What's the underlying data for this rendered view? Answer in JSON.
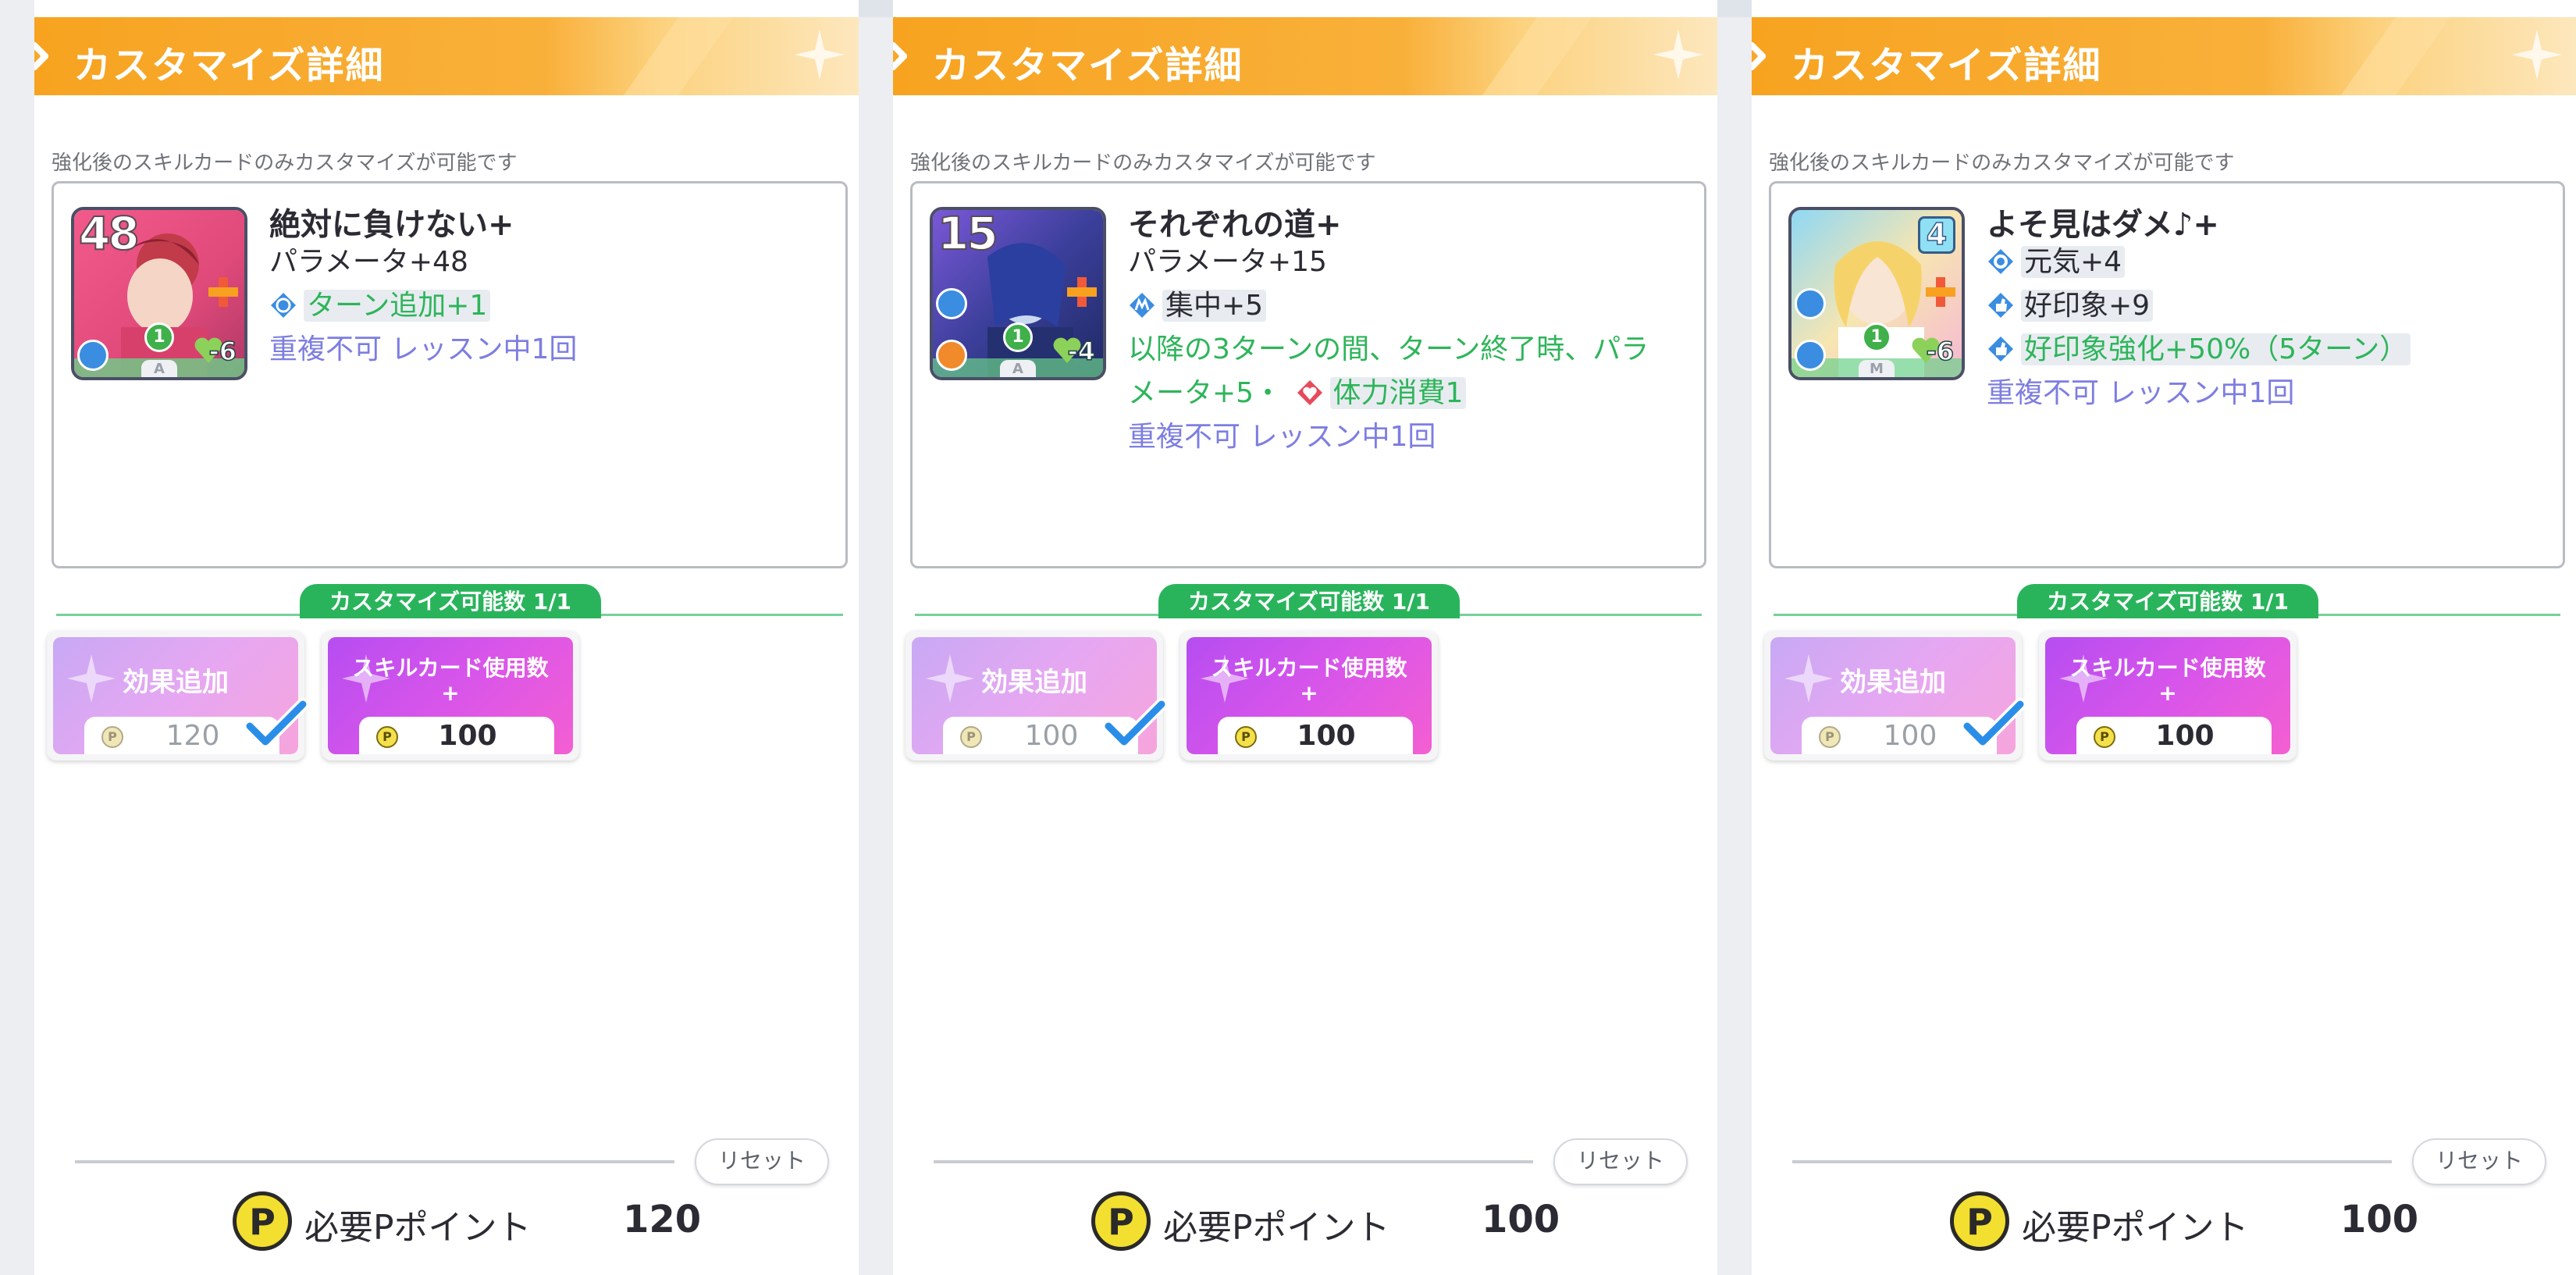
{
  "panels": [
    {
      "title": "カスタマイズ詳細",
      "note": "強化後のスキルカードのみカスタマイズが可能です",
      "card": {
        "cost": "48",
        "level": "1",
        "stamina": "-6",
        "rarity": "A",
        "name": "絶対に負けない+",
        "effects": [
          {
            "text": "パラメータ+48",
            "style": "black"
          },
          {
            "text": "ターン追加+1",
            "style": "green",
            "icon": "turn-icon"
          },
          {
            "text": "重複不可 レッスン中1回",
            "style": "purple"
          }
        ]
      },
      "customize_label": "カスタマイズ可能数 1/1",
      "options": [
        {
          "label": "効果追加",
          "price": "120",
          "selected": true
        },
        {
          "label": "スキルカード使用数+",
          "price": "100",
          "selected": false
        }
      ],
      "reset_label": "リセット",
      "required_label": "必要Pポイント",
      "required_value": "120"
    },
    {
      "title": "カスタマイズ詳細",
      "note": "強化後のスキルカードのみカスタマイズが可能です",
      "card": {
        "cost": "15",
        "level": "1",
        "stamina": "-4",
        "rarity": "A",
        "name": "それぞれの道+",
        "effects": [
          {
            "text": "パラメータ+15",
            "style": "black"
          },
          {
            "text": "集中+5",
            "style": "black",
            "icon": "focus-icon"
          },
          {
            "text": "以降の3ターンの間、ターン終了時、パラ",
            "style": "green"
          },
          {
            "text": "メータ+5・",
            "style": "green",
            "tail": "体力消費1",
            "tail_icon": "heart-icon"
          },
          {
            "text": "重複不可 レッスン中1回",
            "style": "purple"
          }
        ]
      },
      "customize_label": "カスタマイズ可能数 1/1",
      "options": [
        {
          "label": "効果追加",
          "price": "100",
          "selected": true
        },
        {
          "label": "スキルカード使用数+",
          "price": "100",
          "selected": false
        }
      ],
      "reset_label": "リセット",
      "required_label": "必要Pポイント",
      "required_value": "100"
    },
    {
      "title": "カスタマイズ詳細",
      "note": "強化後のスキルカードのみカスタマイズが可能です",
      "card": {
        "cost": "4",
        "level": "1",
        "stamina": "-6",
        "rarity": "M",
        "name": "よそ見はダメ♪+",
        "effects": [
          {
            "text": "元気+4",
            "style": "black",
            "icon": "genki-icon"
          },
          {
            "text": "好印象+9",
            "style": "black",
            "icon": "impression-icon"
          },
          {
            "text": "好印象強化+50%（5ターン）",
            "style": "green",
            "icon": "impression-boost-icon"
          },
          {
            "text": "重複不可 レッスン中1回",
            "style": "purple"
          }
        ]
      },
      "customize_label": "カスタマイズ可能数 1/1",
      "options": [
        {
          "label": "効果追加",
          "price": "100",
          "selected": true
        },
        {
          "label": "スキルカード使用数+",
          "price": "100",
          "selected": false
        }
      ],
      "reset_label": "リセット",
      "required_label": "必要Pポイント",
      "required_value": "100"
    }
  ],
  "colors": {
    "header": "#f7a320",
    "green_text": "#2eb55a",
    "purple_text": "#7d7ee0",
    "pill": "#29b45c",
    "option_add": "#e6a7f2",
    "option_use": "#d855ea"
  }
}
